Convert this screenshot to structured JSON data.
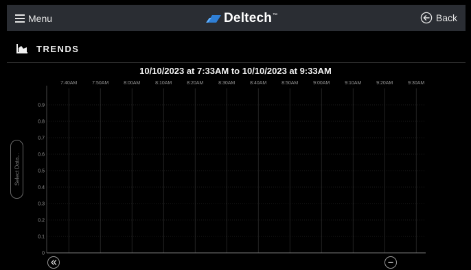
{
  "header": {
    "menu_label": "Menu",
    "logo_text": "Deltech",
    "logo_trademark": "™",
    "back_label": "Back"
  },
  "page": {
    "title": "TRENDS"
  },
  "side_controls": {
    "select_data_label": "Select Data..."
  },
  "icons": {
    "menu": "hamburger-icon",
    "logo": "deltech-logo-mark",
    "back": "circle-arrow-left-icon",
    "trends": "chart-icon",
    "rewind": "double-chevron-left-icon",
    "zoom_out": "minus-icon"
  },
  "colors": {
    "background": "#000000",
    "topbar": "#2a2d33",
    "logo_blue": "#2f7fd6",
    "grid": "#3a3a3a",
    "text": "#f2f2f2",
    "tick": "#9a9a9a"
  },
  "chart_data": {
    "type": "line",
    "title": "10/10/2023 at 7:33AM to 10/10/2023 at 9:33AM",
    "x_tick_labels": [
      "7:40AM",
      "7:50AM",
      "8:00AM",
      "8:10AM",
      "8:20AM",
      "8:30AM",
      "8:40AM",
      "8:50AM",
      "9:00AM",
      "9:10AM",
      "9:20AM",
      "9:30AM"
    ],
    "x_ticks_minutes": [
      7,
      17,
      27,
      37,
      47,
      57,
      67,
      77,
      87,
      97,
      107,
      117
    ],
    "xlim_minutes": [
      0,
      120
    ],
    "x_axis_position": "top",
    "y_ticks": [
      "0",
      "0.1",
      "0.2",
      "0.3",
      "0.4",
      "0.5",
      "0.6",
      "0.7",
      "0.8",
      "0.9"
    ],
    "ylim": [
      0,
      1
    ],
    "grid": true,
    "series": []
  }
}
